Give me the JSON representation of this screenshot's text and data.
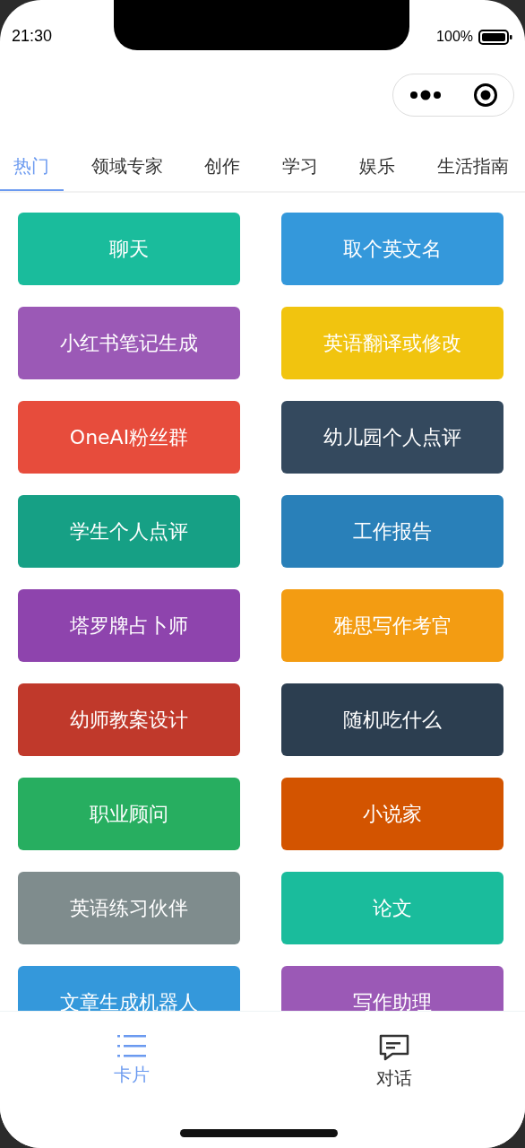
{
  "status_bar": {
    "time": "21:30",
    "battery": "100%"
  },
  "tabs": [
    {
      "label": "热门",
      "selected": true
    },
    {
      "label": "领域专家",
      "selected": false
    },
    {
      "label": "创作",
      "selected": false
    },
    {
      "label": "学习",
      "selected": false
    },
    {
      "label": "娱乐",
      "selected": false
    },
    {
      "label": "生活指南",
      "selected": false
    }
  ],
  "cards": [
    {
      "label": "聊天",
      "color": "#1abc9c"
    },
    {
      "label": "取个英文名",
      "color": "#3498db"
    },
    {
      "label": "小红书笔记生成",
      "color": "#9b59b6"
    },
    {
      "label": "英语翻译或修改",
      "color": "#f1c40f"
    },
    {
      "label": "OneAI粉丝群",
      "color": "#e74c3c"
    },
    {
      "label": "幼儿园个人点评",
      "color": "#34495e"
    },
    {
      "label": "学生个人点评",
      "color": "#16a085"
    },
    {
      "label": "工作报告",
      "color": "#2980b9"
    },
    {
      "label": "塔罗牌占卜师",
      "color": "#8e44ad"
    },
    {
      "label": "雅思写作考官",
      "color": "#f39c12"
    },
    {
      "label": "幼师教案设计",
      "color": "#c0392b"
    },
    {
      "label": "随机吃什么",
      "color": "#2c3e50"
    },
    {
      "label": "职业顾问",
      "color": "#27ae60"
    },
    {
      "label": "小说家",
      "color": "#d35400"
    },
    {
      "label": "英语练习伙伴",
      "color": "#7f8c8d"
    },
    {
      "label": "论文",
      "color": "#1abc9c"
    },
    {
      "label": "文章生成机器人",
      "color": "#3498db"
    },
    {
      "label": "写作助理",
      "color": "#9b59b6"
    }
  ],
  "bottom_nav": [
    {
      "label": "卡片",
      "kind": "list",
      "selected": true
    },
    {
      "label": "对话",
      "kind": "chat",
      "selected": false
    }
  ]
}
